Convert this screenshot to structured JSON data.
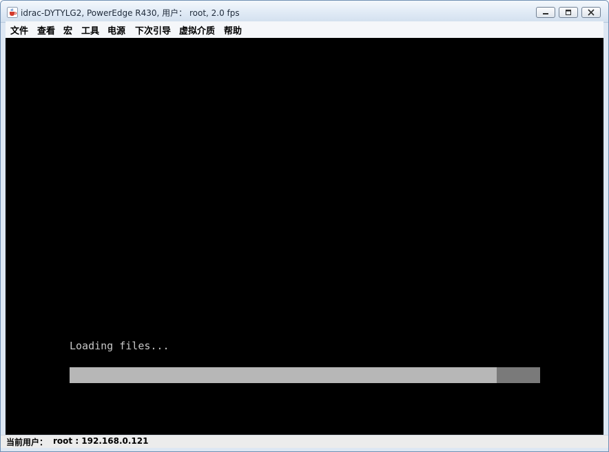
{
  "window": {
    "title": "idrac-DYTYLG2, PowerEdge R430, 用户： root, 2.0 fps",
    "app_icon": "java-cup-icon",
    "controls": [
      "minimize-icon",
      "maximize-icon",
      "close-icon"
    ]
  },
  "menu": {
    "items": [
      {
        "label": "文件"
      },
      {
        "label": "查看"
      },
      {
        "label": "宏"
      },
      {
        "label": "工具"
      },
      {
        "label": "电源"
      },
      {
        "label": "下次引导"
      },
      {
        "label": "虚拟介质"
      },
      {
        "label": "帮助"
      }
    ]
  },
  "console": {
    "message": "Loading files...",
    "progress_fraction": 0.908
  },
  "status": {
    "label": "当前用户：",
    "value": "root : 192.168.0.121"
  },
  "colors": {
    "console_bg": "#000000",
    "console_text": "#c8c8c8",
    "progress_fill": "#b7b7b7",
    "progress_track": "#7a7a7a"
  }
}
